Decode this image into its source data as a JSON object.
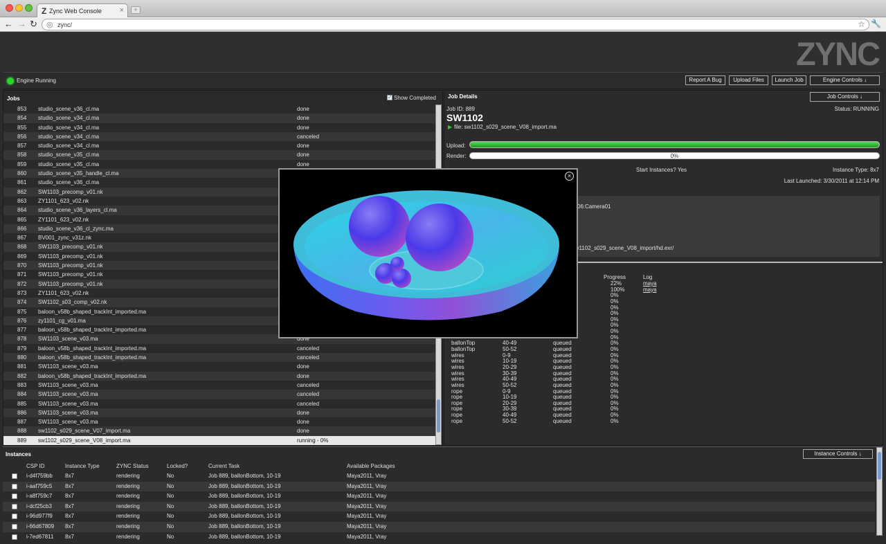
{
  "browser": {
    "tab_title": "Zync Web Console",
    "tab_favicon": "Z",
    "new_tab_glyph": "+",
    "url": "zync/"
  },
  "app": {
    "logo": "ZYNC",
    "engine_status": "Engine Running",
    "buttons": {
      "report_bug": "Report A Bug",
      "upload_files": "Upload Files",
      "launch_job": "Launch Job",
      "engine_controls": "Engine Controls ↓"
    }
  },
  "jobs": {
    "title": "Jobs",
    "show_completed_label": "Show Completed",
    "rows": [
      {
        "id": "853",
        "name": "studio_scene_v36_cl.ma",
        "status": "done"
      },
      {
        "id": "854",
        "name": "studio_scene_v34_cl.ma",
        "status": "done"
      },
      {
        "id": "855",
        "name": "studio_scene_v34_cl.ma",
        "status": "done"
      },
      {
        "id": "856",
        "name": "studio_scene_v34_cl.ma",
        "status": "canceled"
      },
      {
        "id": "857",
        "name": "studio_scene_v34_cl.ma",
        "status": "done"
      },
      {
        "id": "858",
        "name": "studio_scene_v35_cl.ma",
        "status": "done"
      },
      {
        "id": "859",
        "name": "studio_scene_v35_cl.ma",
        "status": "done"
      },
      {
        "id": "860",
        "name": "studio_scene_v35_handle_cl.ma",
        "status": ""
      },
      {
        "id": "861",
        "name": "studio_scene_v36_cl.ma",
        "status": ""
      },
      {
        "id": "862",
        "name": "SW1103_precomp_v01.nk",
        "status": ""
      },
      {
        "id": "863",
        "name": "ZY1101_623_v02.nk",
        "status": ""
      },
      {
        "id": "864",
        "name": "studio_scene_v36_layers_cl.ma",
        "status": ""
      },
      {
        "id": "865",
        "name": "ZY1101_623_v02.nk",
        "status": ""
      },
      {
        "id": "866",
        "name": "studio_scene_v36_cl_zync.ma",
        "status": ""
      },
      {
        "id": "867",
        "name": "BV001_zync_v31z.nk",
        "status": ""
      },
      {
        "id": "868",
        "name": "SW1103_precomp_v01.nk",
        "status": ""
      },
      {
        "id": "869",
        "name": "SW1103_precomp_v01.nk",
        "status": ""
      },
      {
        "id": "870",
        "name": "SW1103_precomp_v01.nk",
        "status": ""
      },
      {
        "id": "871",
        "name": "SW1103_precomp_v01.nk",
        "status": ""
      },
      {
        "id": "872",
        "name": "SW1103_precomp_v01.nk",
        "status": ""
      },
      {
        "id": "873",
        "name": "ZY1101_623_v02.nk",
        "status": ""
      },
      {
        "id": "874",
        "name": "SW1102_s03_comp_v02.nk",
        "status": ""
      },
      {
        "id": "875",
        "name": "baloon_v58b_shaped_trackInt_imported.ma",
        "status": ""
      },
      {
        "id": "876",
        "name": "zy1101_cg_v01.ma",
        "status": ""
      },
      {
        "id": "877",
        "name": "baloon_v58b_shaped_trackInt_imported.ma",
        "status": ""
      },
      {
        "id": "878",
        "name": "SW1103_scene_v03.ma",
        "status": "done"
      },
      {
        "id": "879",
        "name": "baloon_v58b_shaped_trackInt_imported.ma",
        "status": "canceled"
      },
      {
        "id": "880",
        "name": "baloon_v58b_shaped_trackInt_imported.ma",
        "status": "canceled"
      },
      {
        "id": "881",
        "name": "SW1103_scene_v03.ma",
        "status": "done"
      },
      {
        "id": "882",
        "name": "baloon_v58b_shaped_trackInt_imported.ma",
        "status": "done"
      },
      {
        "id": "883",
        "name": "SW1103_scene_v03.ma",
        "status": "canceled"
      },
      {
        "id": "884",
        "name": "SW1103_scene_v03.ma",
        "status": "canceled"
      },
      {
        "id": "885",
        "name": "SW1103_scene_v03.ma",
        "status": "canceled"
      },
      {
        "id": "886",
        "name": "SW1103_scene_v03.ma",
        "status": "done"
      },
      {
        "id": "887",
        "name": "SW1103_scene_v03.ma",
        "status": "done"
      },
      {
        "id": "888",
        "name": "sw1102_s029_scene_V07_import.ma",
        "status": "done"
      },
      {
        "id": "889",
        "name": "sw1102_s029_scene_V08_import.ma",
        "status": "running - 0%"
      }
    ],
    "selected_id": "889"
  },
  "details": {
    "title": "Job Details",
    "job_controls": "Job Controls ↓",
    "job_id": "Job ID: 889",
    "status": "Status: RUNNING",
    "name": "SW1102",
    "file": "file: sw1102_s029_scene_V08_import.ma",
    "upload_label": "Upload:",
    "upload_progress": 1.0,
    "render_label": "Render:",
    "render_progress": 0.0,
    "render_text": "0%",
    "start_instances": "Start Instances? Yes",
    "instance_type": "Instance Type: 8x7",
    "last_launched": "Last Launched: 3/30/2011 at 12:14 PM",
    "camera": "06:Camera01",
    "output_path": "g/sw1102_s029_scene_V08_import/hd.exr/",
    "task_headers": {
      "progress": "Progress",
      "log": "Log"
    },
    "tasks": [
      {
        "layer": "",
        "frames": "",
        "status": "",
        "progress": "22%",
        "log": "maya"
      },
      {
        "layer": "",
        "frames": "",
        "status": "",
        "progress": "100%",
        "log": "maya"
      },
      {
        "layer": "",
        "frames": "",
        "status": "",
        "progress": "0%",
        "log": ""
      },
      {
        "layer": "",
        "frames": "",
        "status": "",
        "progress": "0%",
        "log": ""
      },
      {
        "layer": "",
        "frames": "",
        "status": "",
        "progress": "0%",
        "log": ""
      },
      {
        "layer": "",
        "frames": "",
        "status": "",
        "progress": "0%",
        "log": ""
      },
      {
        "layer": "",
        "frames": "",
        "status": "",
        "progress": "0%",
        "log": ""
      },
      {
        "layer": "",
        "frames": "",
        "status": "",
        "progress": "0%",
        "log": ""
      },
      {
        "layer": "",
        "frames": "",
        "status": "",
        "progress": "0%",
        "log": ""
      },
      {
        "layer": "",
        "frames": "",
        "status": "",
        "progress": "0%",
        "log": ""
      },
      {
        "layer": "ballonTop",
        "frames": "40-49",
        "status": "queued",
        "progress": "0%",
        "log": ""
      },
      {
        "layer": "ballonTop",
        "frames": "50-52",
        "status": "queued",
        "progress": "0%",
        "log": ""
      },
      {
        "layer": "wires",
        "frames": "0-9",
        "status": "queued",
        "progress": "0%",
        "log": ""
      },
      {
        "layer": "wires",
        "frames": "10-19",
        "status": "queued",
        "progress": "0%",
        "log": ""
      },
      {
        "layer": "wires",
        "frames": "20-29",
        "status": "queued",
        "progress": "0%",
        "log": ""
      },
      {
        "layer": "wires",
        "frames": "30-39",
        "status": "queued",
        "progress": "0%",
        "log": ""
      },
      {
        "layer": "wires",
        "frames": "40-49",
        "status": "queued",
        "progress": "0%",
        "log": ""
      },
      {
        "layer": "wires",
        "frames": "50-52",
        "status": "queued",
        "progress": "0%",
        "log": ""
      },
      {
        "layer": "rope",
        "frames": "0-9",
        "status": "queued",
        "progress": "0%",
        "log": ""
      },
      {
        "layer": "rope",
        "frames": "10-19",
        "status": "queued",
        "progress": "0%",
        "log": ""
      },
      {
        "layer": "rope",
        "frames": "20-29",
        "status": "queued",
        "progress": "0%",
        "log": ""
      },
      {
        "layer": "rope",
        "frames": "30-39",
        "status": "queued",
        "progress": "0%",
        "log": ""
      },
      {
        "layer": "rope",
        "frames": "40-49",
        "status": "queued",
        "progress": "0%",
        "log": ""
      },
      {
        "layer": "rope",
        "frames": "50-52",
        "status": "queued",
        "progress": "0%",
        "log": ""
      }
    ]
  },
  "instances": {
    "title": "Instances",
    "controls": "Instance Controls ↓",
    "headers": [
      "CSP ID",
      "Instance Type",
      "ZYNC Status",
      "Locked?",
      "Current Task",
      "Available Packages"
    ],
    "rows": [
      [
        "i-d4f759bb",
        "8x7",
        "rendering",
        "No",
        "Job 889, ballonBottom, 10-19",
        "Maya2011, Vray"
      ],
      [
        "i-aaf759c5",
        "8x7",
        "rendering",
        "No",
        "Job 889, ballonBottom, 10-19",
        "Maya2011, Vray"
      ],
      [
        "i-a8f759c7",
        "8x7",
        "rendering",
        "No",
        "Job 889, ballonBottom, 10-19",
        "Maya2011, Vray"
      ],
      [
        "i-dcf25cb3",
        "8x7",
        "rendering",
        "No",
        "Job 889, ballonBottom, 10-19",
        "Maya2011, Vray"
      ],
      [
        "i-96d977f9",
        "8x7",
        "rendering",
        "No",
        "Job 889, ballonBottom, 10-19",
        "Maya2011, Vray"
      ],
      [
        "i-66d67809",
        "8x7",
        "rendering",
        "No",
        "Job 889, ballonBottom, 10-19",
        "Maya2011, Vray"
      ],
      [
        "i-7ed67811",
        "8x7",
        "rendering",
        "No",
        "Job 889, ballonBottom, 10-19",
        "Maya2011, Vray"
      ]
    ]
  },
  "modal": {
    "close_glyph": "×"
  }
}
